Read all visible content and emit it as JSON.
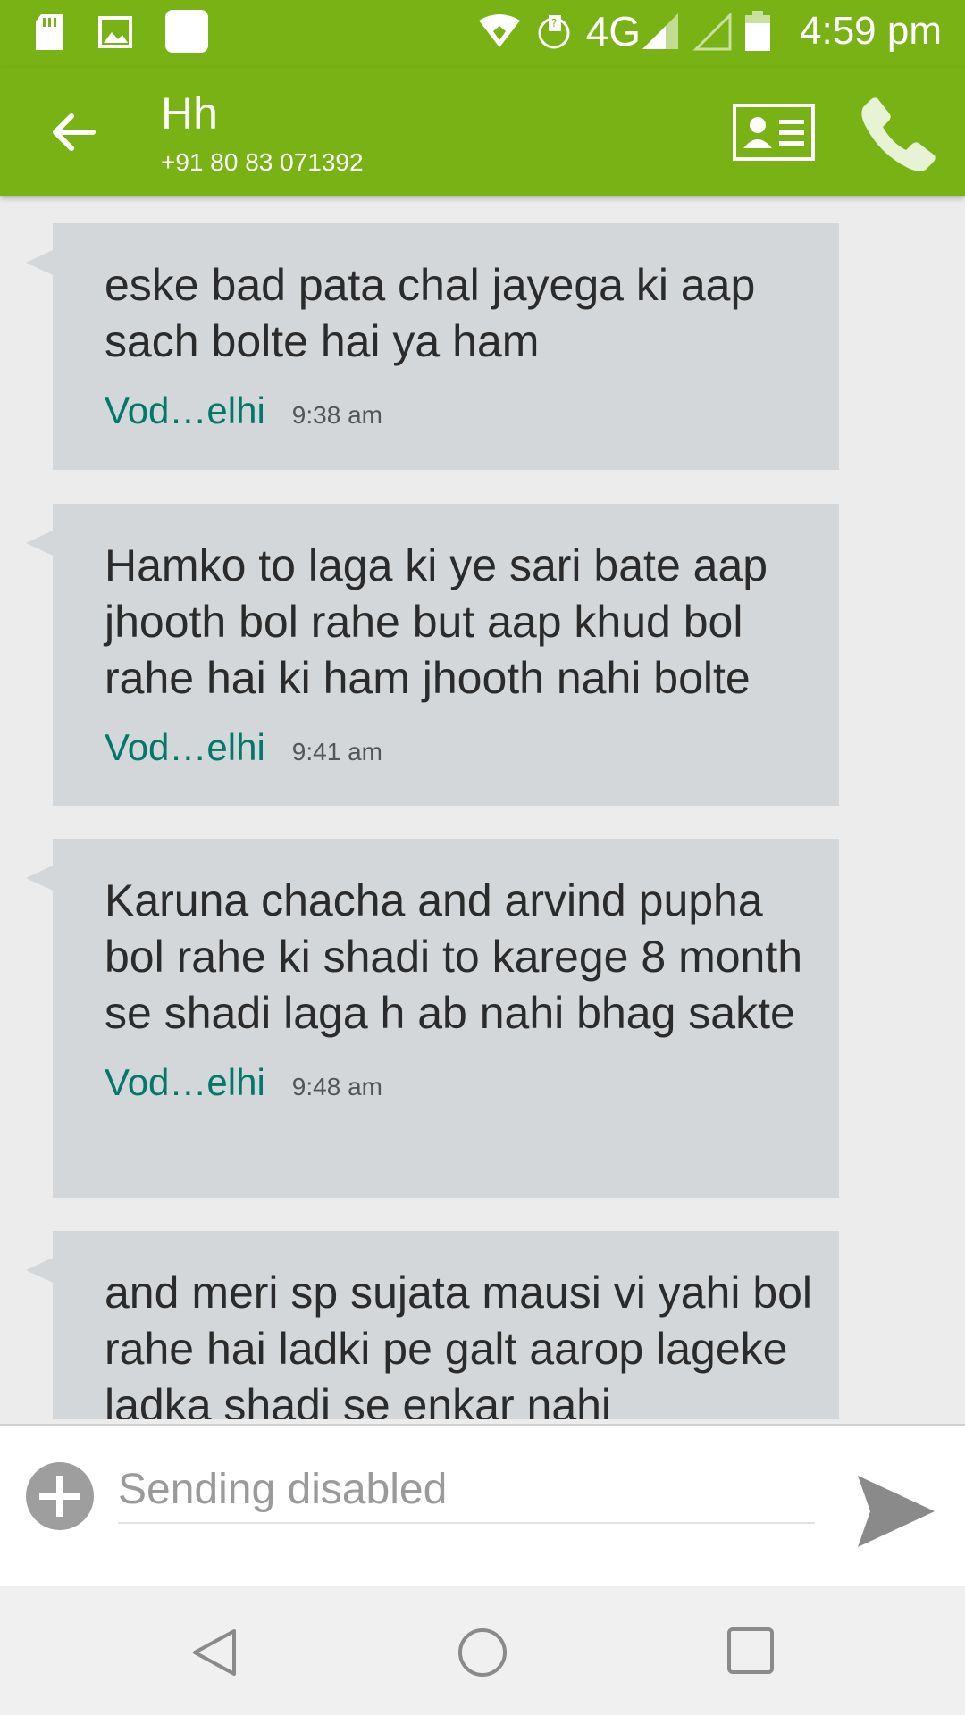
{
  "status_bar": {
    "network": "4G",
    "time": "4:59 pm",
    "icons": [
      "sd-card-icon",
      "image-icon",
      "app-icon",
      "wifi-icon",
      "data-sync-icon",
      "signal-icon",
      "signal-empty-icon",
      "battery-icon"
    ]
  },
  "header": {
    "contact_name": "Hh",
    "contact_number": "+91 80 83 071392",
    "icons": [
      "back-arrow-icon",
      "contact-card-icon",
      "phone-icon"
    ]
  },
  "messages": [
    {
      "text": "eske bad pata chal jayega ki aap sach bolte hai ya ham",
      "sim": "Vod…elhi",
      "time": "9:38 am"
    },
    {
      "text": "Hamko to laga ki ye sari bate aap jhooth bol rahe but aap khud bol rahe hai ki ham jhooth nahi bolte",
      "sim": "Vod…elhi",
      "time": "9:41 am"
    },
    {
      "text": "Karuna chacha and arvind pupha bol rahe ki shadi to karege 8 month se shadi laga h ab nahi bhag sakte",
      "sim": "Vod…elhi",
      "time": "9:48 am"
    },
    {
      "text": "and meri sp sujata mausi  vi yahi bol rahe hai ladki pe galt aarop lageke ladka shadi se enkar nahi",
      "sim": "",
      "time": ""
    }
  ],
  "compose": {
    "placeholder": "Sending disabled"
  },
  "colors": {
    "brand_green": "#78b214",
    "bubble": "#d4d7da",
    "sim_label": "#00796b"
  }
}
